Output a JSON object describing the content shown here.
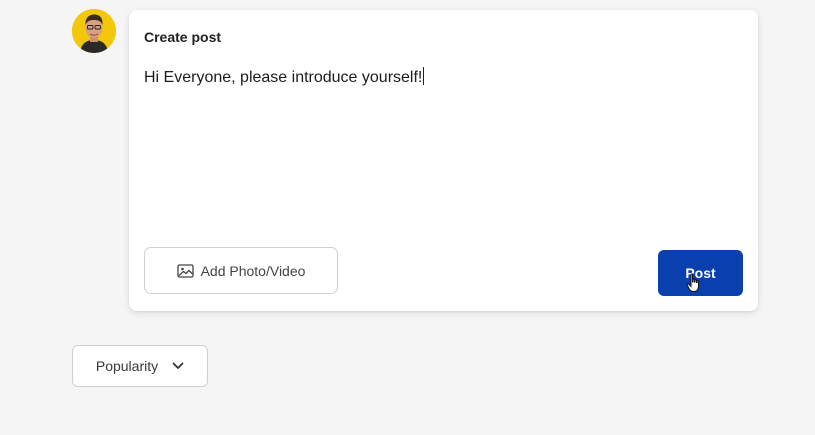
{
  "user": {
    "avatar_icon": "user-avatar"
  },
  "composer": {
    "title": "Create post",
    "text": "Hi Everyone, please introduce yourself!",
    "add_media_label": "Add Photo/Video",
    "add_media_icon": "image-icon",
    "post_label": "Post"
  },
  "feed": {
    "sort_value": "Popularity",
    "sort_icon": "chevron-down-icon"
  },
  "colors": {
    "accent": "#0a3fae",
    "background": "#f5f5f5",
    "avatar_bg": "#f2c70c"
  }
}
